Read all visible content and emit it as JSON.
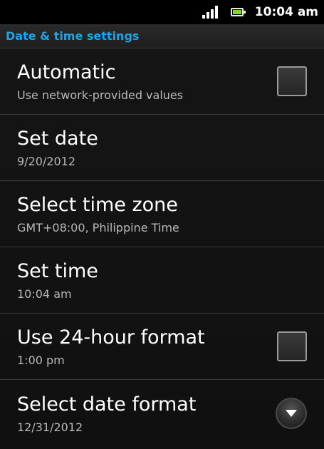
{
  "status_bar": {
    "time": "10:04 am",
    "signal_icon": "signal-icon",
    "battery_icon": "battery-icon",
    "battery_color": "#7fd82a"
  },
  "header": {
    "title": "Date & time settings",
    "title_color": "#1fa3e6"
  },
  "settings": [
    {
      "title": "Automatic",
      "subtitle": "Use network-provided values",
      "control": "checkbox",
      "checked": false
    },
    {
      "title": "Set date",
      "subtitle": "9/20/2012"
    },
    {
      "title": "Select time zone",
      "subtitle": "GMT+08:00, Philippine Time"
    },
    {
      "title": "Set time",
      "subtitle": "10:04 am"
    },
    {
      "title": "Use 24-hour format",
      "subtitle": "1:00 pm",
      "control": "checkbox",
      "checked": false
    },
    {
      "title": "Select date format",
      "subtitle": "12/31/2012",
      "control": "dropdown"
    }
  ]
}
